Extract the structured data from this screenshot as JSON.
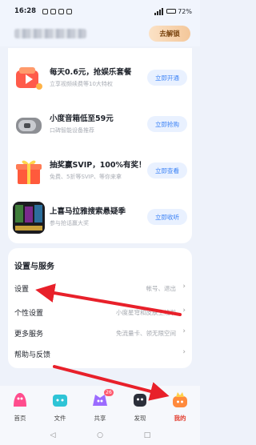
{
  "status_bar": {
    "time": "16:28",
    "battery": "72%"
  },
  "header": {
    "unlock_label": "去解锁"
  },
  "promos": [
    {
      "title": "每天0.6元，抢娱乐套餐",
      "subtitle": "立享视频续费等10大特权",
      "button": "立即开通",
      "icon": "play-gift-icon"
    },
    {
      "title": "小度音箱低至59元",
      "subtitle": "口碑智能设备推荐",
      "button": "立即抢购",
      "icon": "smart-speaker-icon"
    },
    {
      "title": "抽奖赢SVIP，100%有奖！",
      "subtitle": "免费、5折等SVIP、等你来拿",
      "button": "立即查看",
      "icon": "gift-box-icon"
    },
    {
      "title": "上喜马拉雅搜索悬疑季",
      "subtitle": "参与抢话赢大奖",
      "button": "立即收听",
      "icon": "poster-image"
    }
  ],
  "settings": {
    "heading": "设置与服务",
    "rows": [
      {
        "label": "设置",
        "value": "帐号、退出"
      },
      {
        "label": "个性设置",
        "value": "小度星穹和皮肤上线啦"
      },
      {
        "label": "更多服务",
        "value": "免流量卡、领无限空间"
      },
      {
        "label": "帮助与反馈",
        "value": ""
      }
    ]
  },
  "tabs": [
    {
      "label": "首页",
      "icon": "home-icon",
      "color": "#ff4d8d"
    },
    {
      "label": "文件",
      "icon": "files-icon",
      "color": "#2ec4d6"
    },
    {
      "label": "共享",
      "icon": "share-icon",
      "color": "#9b6bff",
      "badge": "26"
    },
    {
      "label": "发现",
      "icon": "discover-icon",
      "color": "#2b2f3a"
    },
    {
      "label": "我的",
      "icon": "profile-icon",
      "color": "#ff8a3d",
      "active": true
    }
  ],
  "annotation_color": "#e8202a"
}
